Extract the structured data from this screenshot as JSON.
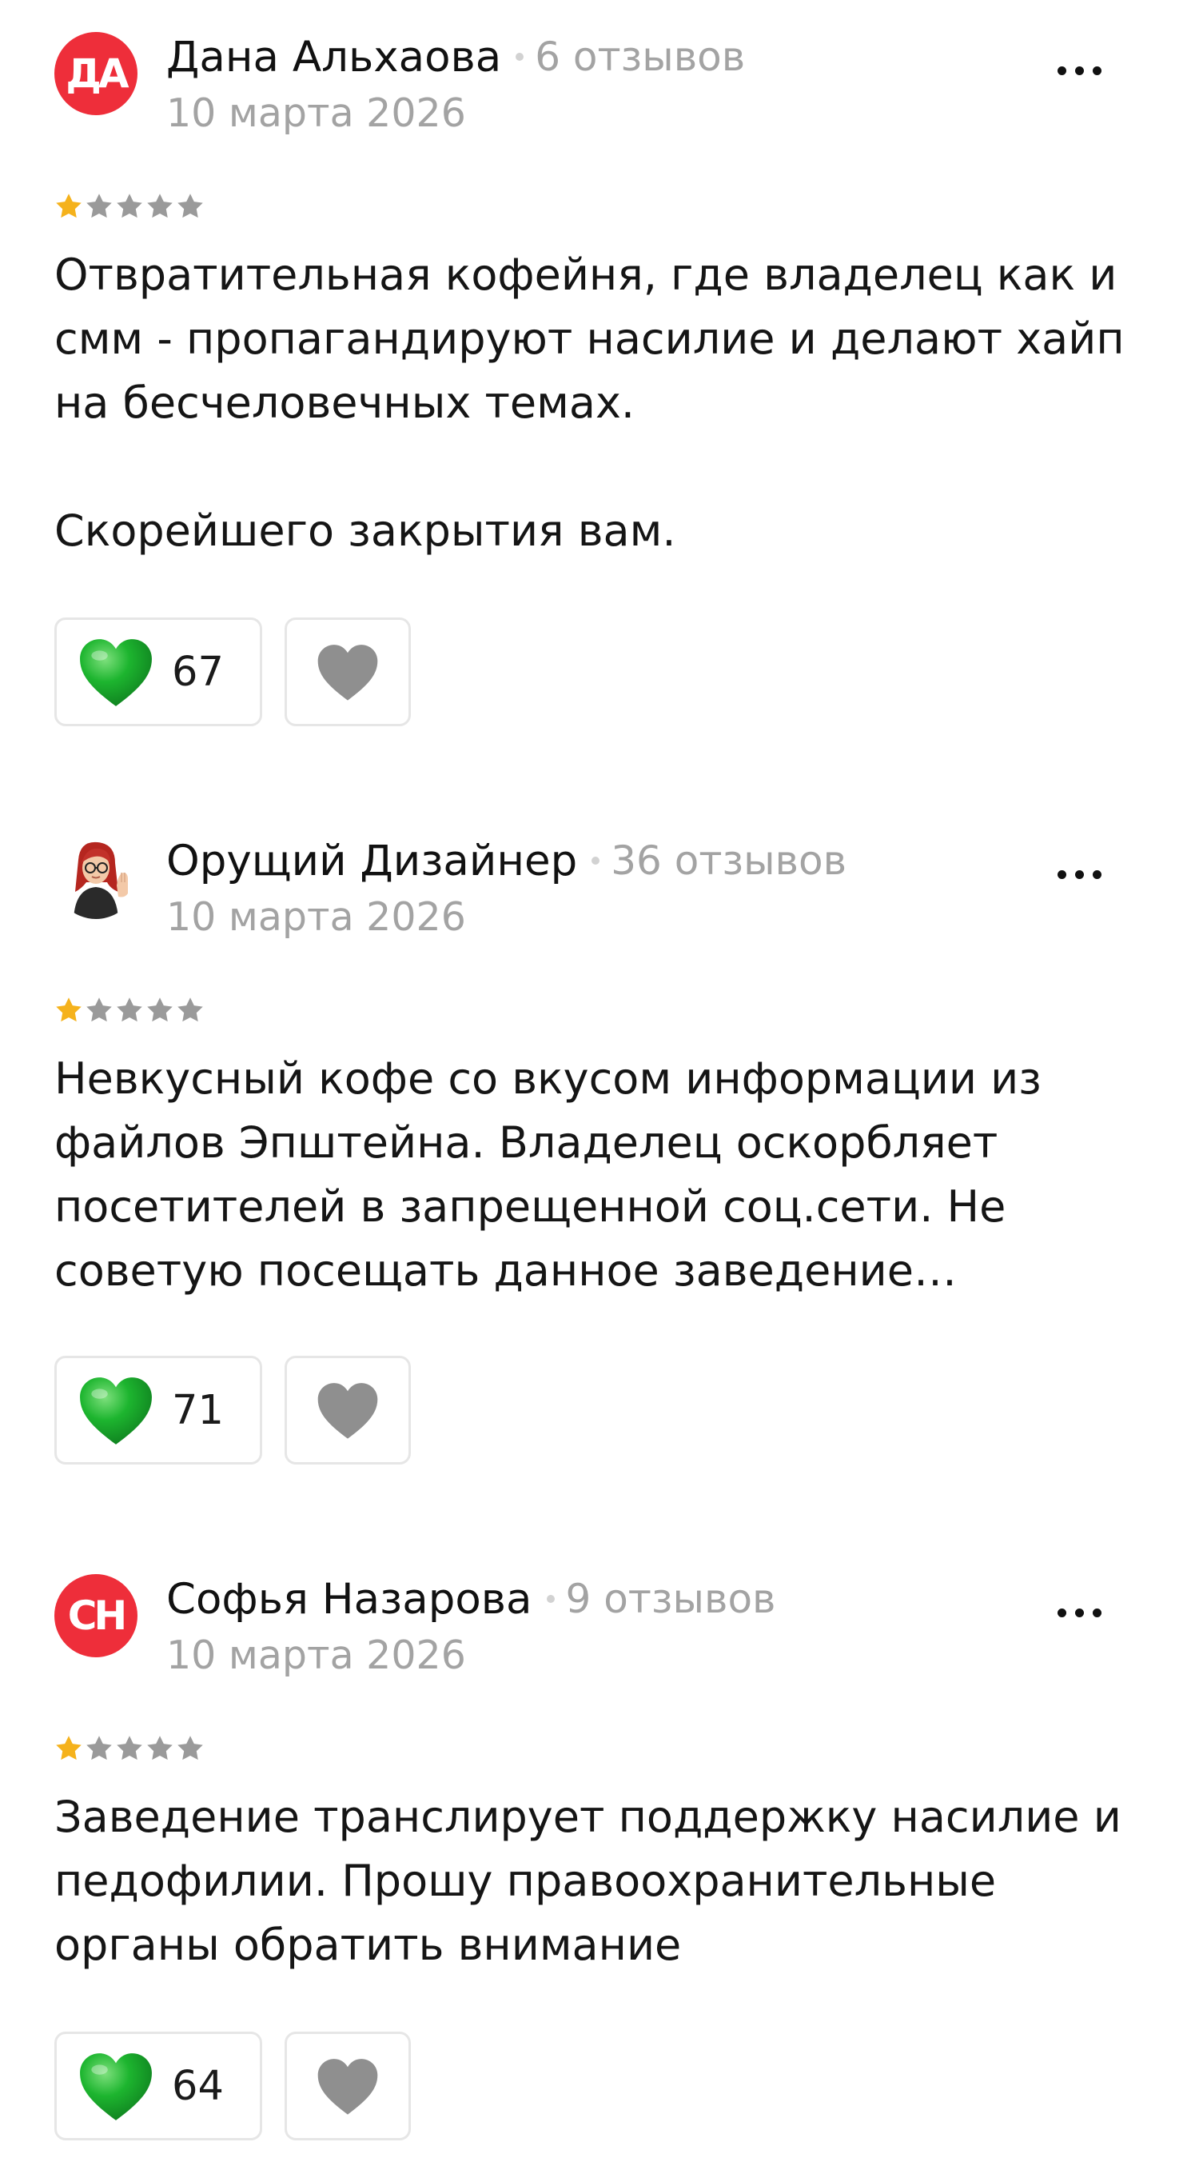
{
  "colors": {
    "avatar_red": "#ee2e3a",
    "star_filled": "#f5b21c",
    "star_empty": "#9a9a9a",
    "like_heart": "#1db52f",
    "dislike_heart": "#8f8f8f",
    "meta_gray": "#a3a3a3"
  },
  "reviews": [
    {
      "author": {
        "initials": "ДА",
        "avatar": "initials-red-circle",
        "name": "Дана Альхаова",
        "reviews_count": "6 отзывов"
      },
      "date": "10 марта 2026",
      "rating": 1,
      "rating_max": 5,
      "text": "Отвратительная кофейня, где владелец как и\nсмм - пропагандируют насилие и делают хайп\nна бесчеловечных темах.\n\nСкорейшего закрытия вам.",
      "likes": "67",
      "icons": {
        "more": "more-dots-icon",
        "like": "heart-icon",
        "dislike": "heart-outline-icon"
      }
    },
    {
      "author": {
        "initials": "",
        "avatar": "photo-avatar",
        "name": "Орущий Дизайнер",
        "reviews_count": "36 отзывов"
      },
      "date": "10 марта 2026",
      "rating": 1,
      "rating_max": 5,
      "text": "Невкусный кофе со вкусом информации из\nфайлов Эпштейна. Владелец оскорбляет\nпосетителей в запрещенной соц.сети. Не\nсоветую посещать данное заведение…",
      "likes": "71",
      "icons": {
        "more": "more-dots-icon",
        "like": "heart-icon",
        "dislike": "heart-outline-icon"
      }
    },
    {
      "author": {
        "initials": "СН",
        "avatar": "initials-red-circle",
        "name": "Софья Назарова",
        "reviews_count": "9 отзывов"
      },
      "date": "10 марта 2026",
      "rating": 1,
      "rating_max": 5,
      "text": "Заведение транслирует поддержку насилие и\nпедофилии. Прошу правоохранительные\nорганы обратить внимание",
      "likes": "64",
      "icons": {
        "more": "more-dots-icon",
        "like": "heart-icon",
        "dislike": "heart-outline-icon"
      }
    }
  ]
}
